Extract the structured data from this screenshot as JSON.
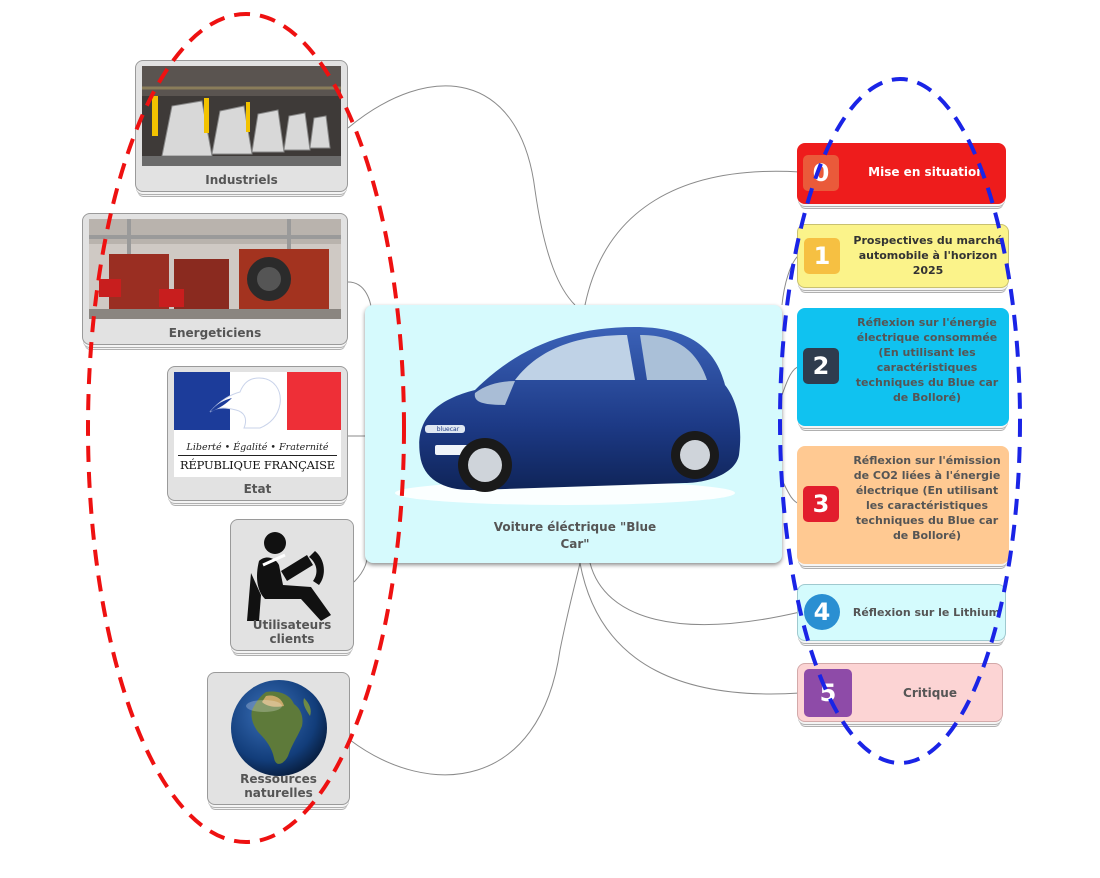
{
  "center": {
    "label": "Voiture éléctrique \"Blue Car\"",
    "plate_text": "bluecar"
  },
  "left_nodes": [
    {
      "label": "Industriels",
      "icon": "factory-photo-icon"
    },
    {
      "label": "Energeticiens",
      "icon": "boiler-room-photo-icon"
    },
    {
      "label": "Etat",
      "icon": "marianne-logo-icon",
      "logo_motto": "Liberté • Égalité • Fraternité",
      "logo_title": "RÉPUBLIQUE FRANÇAISE"
    },
    {
      "label": "Utilisateurs clients",
      "icon": "driver-icon"
    },
    {
      "label": "Ressources naturelles",
      "icon": "earth-globe-icon"
    }
  ],
  "right_nodes": [
    {
      "number": "0",
      "text": "Mise en situation",
      "bg": "#ee1c1c",
      "badge": "#ea5a3a",
      "text_color": "#ffffff"
    },
    {
      "number": "1",
      "text": "Prospectives du marché automobile à l'horizon 2025",
      "bg": "#fbf38a",
      "badge": "#f6c042",
      "text_color": "#333333"
    },
    {
      "number": "2",
      "text": "Réflexion sur l'énergie électrique consommée (En utilisant les caractéristiques techniques du Blue car de Bolloré)",
      "bg": "#10c2f0",
      "badge": "#2f3c4e",
      "text_color": "#555555"
    },
    {
      "number": "3",
      "text": "Réflexion sur l'émission de CO2 liées à l'énergie électrique (En utilisant les caractéristiques techniques du Blue car de Bolloré)",
      "bg": "#ffc992",
      "badge": "#e21d2d",
      "text_color": "#555555"
    },
    {
      "number": "4",
      "text": "Réflexion sur le Lithium",
      "bg": "#d4fbfd",
      "badge": "#2a8fd2",
      "text_color": "#555555"
    },
    {
      "number": "5",
      "text": "Critique",
      "bg": "#fcd4d4",
      "badge": "#8e4ba8",
      "text_color": "#555555"
    }
  ],
  "highlights": {
    "left_ellipse_color": "#ee1111",
    "right_ellipse_color": "#1a24e6"
  }
}
